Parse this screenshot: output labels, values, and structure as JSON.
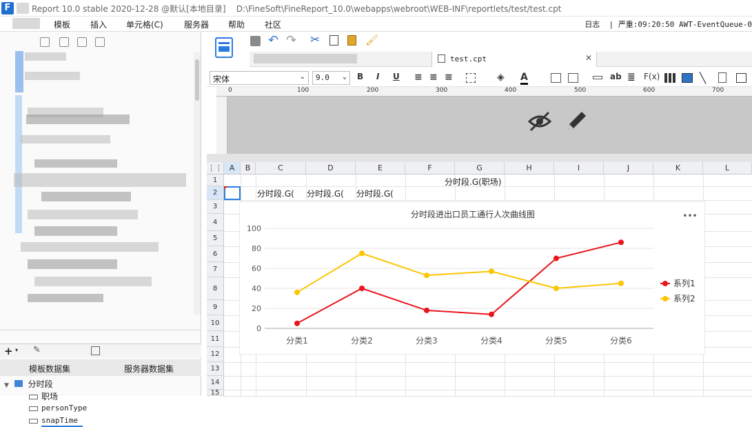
{
  "titlebar": {
    "app_title": "Report 10.0 stable 2020-12-28 @默认[本地目录]",
    "path": "D:\\FineSoft\\FineReport_10.0\\webapps\\webroot\\WEB-INF\\reportlets/test/test.cpt"
  },
  "menu": {
    "items": [
      "模板",
      "插入",
      "单元格(C)",
      "服务器",
      "帮助",
      "社区"
    ],
    "log": "日志",
    "status": "严重:09:20:50 AWT-EventQueue-0"
  },
  "dataset_panel": {
    "tab_template": "模板数据集",
    "tab_server": "服务器数据集",
    "root": "分时段",
    "fields": [
      "职场",
      "personType",
      "snapTime"
    ]
  },
  "tabs": {
    "active": "test.cpt"
  },
  "format": {
    "font": "宋体",
    "size": "9.0",
    "bold": "B",
    "italic": "I",
    "underline": "U",
    "text_ab": "ab",
    "fx": "F(x)"
  },
  "ruler": {
    "marks": [
      "0",
      "100",
      "200",
      "300",
      "400",
      "500",
      "600",
      "700"
    ]
  },
  "grid": {
    "columns": [
      "A",
      "B",
      "C",
      "D",
      "E",
      "F",
      "G",
      "H",
      "I",
      "J",
      "K",
      "L"
    ],
    "rows": [
      "1",
      "2",
      "3",
      "4",
      "5",
      "6",
      "7",
      "8",
      "9",
      "10",
      "11",
      "12",
      "13",
      "14",
      "15"
    ],
    "g1": "分时段.G(职场)",
    "c2": "分时段.G(",
    "d2": "分时段.G(",
    "e2": "分时段.G("
  },
  "chart_data": {
    "type": "line",
    "title": "分时段进出口员工通行人次曲线图",
    "categories": [
      "分类1",
      "分类2",
      "分类3",
      "分类4",
      "分类5",
      "分类6"
    ],
    "series": [
      {
        "name": "系列1",
        "color": "#e8151b",
        "values": [
          5,
          40,
          18,
          14,
          70,
          86
        ]
      },
      {
        "name": "系列2",
        "color": "#fcc500",
        "values": [
          36,
          75,
          53,
          57,
          40,
          45
        ]
      }
    ],
    "ylim": [
      0,
      100
    ],
    "yticks": [
      0,
      20,
      40,
      60,
      80,
      100
    ],
    "legend": "right",
    "grid": true,
    "more_label": "•••"
  }
}
